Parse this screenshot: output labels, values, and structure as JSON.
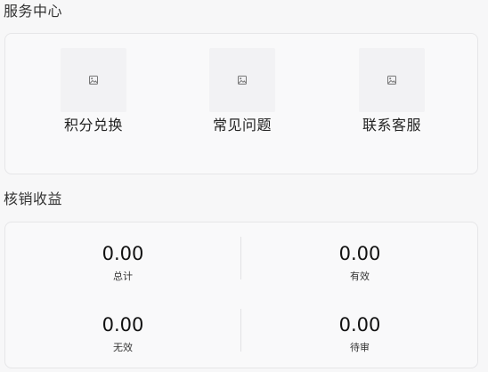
{
  "service_center": {
    "title": "服务中心",
    "items": [
      {
        "label": "积分兑换",
        "icon": "image-placeholder-icon"
      },
      {
        "label": "常见问题",
        "icon": "image-placeholder-icon"
      },
      {
        "label": "联系客服",
        "icon": "image-placeholder-icon"
      }
    ]
  },
  "earnings": {
    "title": "核销收益",
    "stats": [
      {
        "value": "0.00",
        "label": "总计"
      },
      {
        "value": "0.00",
        "label": "有效"
      },
      {
        "value": "0.00",
        "label": "无效"
      },
      {
        "value": "0.00",
        "label": "待审"
      }
    ]
  },
  "colors": {
    "background": "#f7f7f8",
    "card_background": "#f9f9fa",
    "card_border": "#e6e6e8",
    "thumb_background": "#f2f2f4",
    "text": "#222222"
  }
}
